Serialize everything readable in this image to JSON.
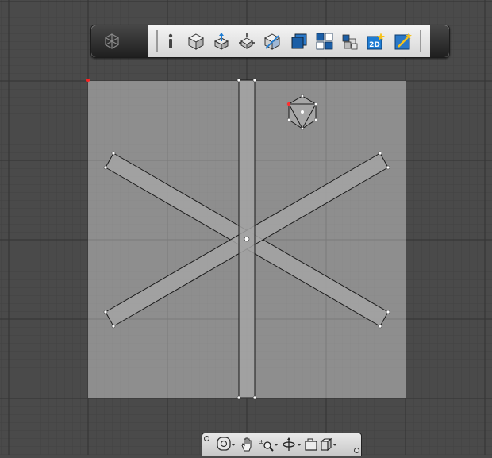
{
  "app": {
    "type": "3d-modeling-viewport",
    "colors": {
      "background": "#4a4a4a",
      "drawing_area": "#8c8c8c",
      "shape_fill": "#a3a3a3",
      "grid_line_major": "#3a3a3a",
      "grid_line_on_area": "#7c7c7c",
      "selection_handle": "#ffffff",
      "origin_marker": "#ff2020",
      "accent_blue": "#1f7dd4"
    }
  },
  "top_toolbar": {
    "items": [
      {
        "icon": "viewcube-logo-icon"
      },
      {
        "icon": "info-icon"
      },
      {
        "icon": "cube-view-icon"
      },
      {
        "icon": "move-gizmo-icon"
      },
      {
        "icon": "rotate-gizmo-icon"
      },
      {
        "icon": "cube-slice-icon"
      },
      {
        "icon": "solid-cube-icon"
      },
      {
        "icon": "grid-layout-icon"
      },
      {
        "icon": "blocks-icon"
      },
      {
        "icon": "2d-view-icon",
        "label": "2D"
      },
      {
        "icon": "magic-wand-icon"
      }
    ]
  },
  "bottom_toolbar": {
    "items": [
      {
        "icon": "orbit-icon"
      },
      {
        "icon": "pan-hand-icon"
      },
      {
        "icon": "zoom-icon"
      },
      {
        "icon": "walk-axis-icon"
      },
      {
        "icon": "camera-views-icon"
      }
    ]
  },
  "model": {
    "description_shapes": [
      "vertical-bar",
      "diagonal-bar-1",
      "diagonal-bar-2",
      "small-hexagon-part"
    ]
  }
}
